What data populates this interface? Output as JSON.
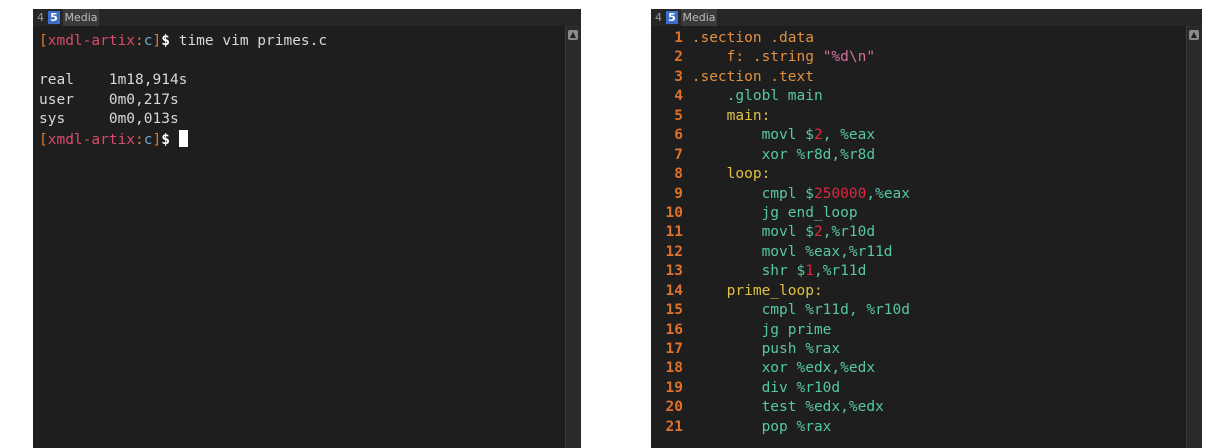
{
  "left": {
    "tabs": [
      "4",
      "5",
      "Media"
    ],
    "lines": [
      {
        "type": "prompt",
        "host": "xmdl-artix",
        "dir": "c",
        "cmd": "time vim primes.c"
      },
      {
        "type": "text",
        "text": ""
      },
      {
        "type": "text",
        "text": "real    1m18,914s"
      },
      {
        "type": "text",
        "text": "user    0m0,217s"
      },
      {
        "type": "text",
        "text": "sys     0m0,013s"
      },
      {
        "type": "prompt",
        "host": "xmdl-artix",
        "dir": "c",
        "cmd": ""
      }
    ]
  },
  "right": {
    "tabs": [
      "4",
      "5",
      "Media"
    ],
    "lines": [
      {
        "n": "1",
        "indent": 0,
        "parts": [
          {
            "t": ".section .data",
            "c": "dir"
          }
        ]
      },
      {
        "n": "2",
        "indent": 1,
        "parts": [
          {
            "t": "f: .string ",
            "c": "dir"
          },
          {
            "t": "\"%d\\n\"",
            "c": "str"
          }
        ]
      },
      {
        "n": "3",
        "indent": 0,
        "parts": [
          {
            "t": ".section .text",
            "c": "dir"
          }
        ]
      },
      {
        "n": "4",
        "indent": 1,
        "parts": [
          {
            "t": ".globl main",
            "c": "src"
          }
        ]
      },
      {
        "n": "5",
        "indent": 1,
        "parts": [
          {
            "t": "main:",
            "c": "lbl"
          }
        ]
      },
      {
        "n": "6",
        "indent": 2,
        "parts": [
          {
            "t": "movl $",
            "c": "src"
          },
          {
            "t": "2",
            "c": "num"
          },
          {
            "t": ", %eax",
            "c": "src"
          }
        ]
      },
      {
        "n": "7",
        "indent": 2,
        "parts": [
          {
            "t": "xor %r8d,%r8d",
            "c": "src"
          }
        ]
      },
      {
        "n": "8",
        "indent": 1,
        "parts": [
          {
            "t": "loop:",
            "c": "lbl"
          }
        ]
      },
      {
        "n": "9",
        "indent": 2,
        "parts": [
          {
            "t": "cmpl $",
            "c": "src"
          },
          {
            "t": "250000",
            "c": "num"
          },
          {
            "t": ",%eax",
            "c": "src"
          }
        ]
      },
      {
        "n": "10",
        "indent": 2,
        "parts": [
          {
            "t": "jg end_loop",
            "c": "src"
          }
        ]
      },
      {
        "n": "11",
        "indent": 2,
        "parts": [
          {
            "t": "movl $",
            "c": "src"
          },
          {
            "t": "2",
            "c": "num"
          },
          {
            "t": ",%r10d",
            "c": "src"
          }
        ]
      },
      {
        "n": "12",
        "indent": 2,
        "parts": [
          {
            "t": "movl %eax,%r11d",
            "c": "src"
          }
        ]
      },
      {
        "n": "13",
        "indent": 2,
        "parts": [
          {
            "t": "shr $",
            "c": "src"
          },
          {
            "t": "1",
            "c": "num"
          },
          {
            "t": ",%r11d",
            "c": "src"
          }
        ]
      },
      {
        "n": "14",
        "indent": 1,
        "parts": [
          {
            "t": "prime_loop:",
            "c": "lbl"
          }
        ]
      },
      {
        "n": "15",
        "indent": 2,
        "parts": [
          {
            "t": "cmpl %r11d, %r10d",
            "c": "src"
          }
        ]
      },
      {
        "n": "16",
        "indent": 2,
        "parts": [
          {
            "t": "jg prime",
            "c": "src"
          }
        ]
      },
      {
        "n": "17",
        "indent": 2,
        "parts": [
          {
            "t": "push %rax",
            "c": "src"
          }
        ]
      },
      {
        "n": "18",
        "indent": 2,
        "parts": [
          {
            "t": "xor %edx,%edx",
            "c": "src"
          }
        ]
      },
      {
        "n": "19",
        "indent": 2,
        "parts": [
          {
            "t": "div %r10d",
            "c": "src"
          }
        ]
      },
      {
        "n": "20",
        "indent": 2,
        "parts": [
          {
            "t": "test %edx,%edx",
            "c": "src"
          }
        ]
      },
      {
        "n": "21",
        "indent": 2,
        "parts": [
          {
            "t": "pop %rax",
            "c": "src"
          }
        ]
      }
    ]
  },
  "colors": {
    "panel_bg": "#1e1e1e",
    "line_number": "#e0712b",
    "active_tab": "#3c6fc7",
    "prompt_host": "#d94b6a"
  }
}
